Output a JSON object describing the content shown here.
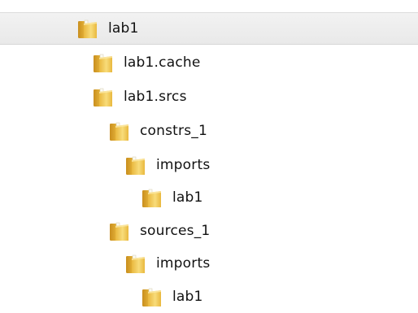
{
  "tree": {
    "items": [
      {
        "label": "lab1",
        "icon": "folder-icon",
        "depth": 0,
        "selected": true
      },
      {
        "label": "lab1.cache",
        "icon": "folder-icon",
        "depth": 1,
        "selected": false
      },
      {
        "label": "lab1.srcs",
        "icon": "folder-icon",
        "depth": 1,
        "selected": false
      },
      {
        "label": "constrs_1",
        "icon": "folder-icon",
        "depth": 2,
        "selected": false
      },
      {
        "label": "imports",
        "icon": "folder-icon",
        "depth": 3,
        "selected": false
      },
      {
        "label": "lab1",
        "icon": "folder-icon",
        "depth": 4,
        "selected": false
      },
      {
        "label": "sources_1",
        "icon": "folder-icon",
        "depth": 2,
        "selected": false
      },
      {
        "label": "imports",
        "icon": "folder-icon",
        "depth": 3,
        "selected": false
      },
      {
        "label": "lab1",
        "icon": "folder-icon",
        "depth": 4,
        "selected": false
      }
    ]
  },
  "colors": {
    "folder_light": "#f8dc7a",
    "folder_mid": "#e9b83e",
    "folder_dark": "#c98f1e",
    "paper": "#fbfbf4",
    "selection": "#ececec"
  }
}
